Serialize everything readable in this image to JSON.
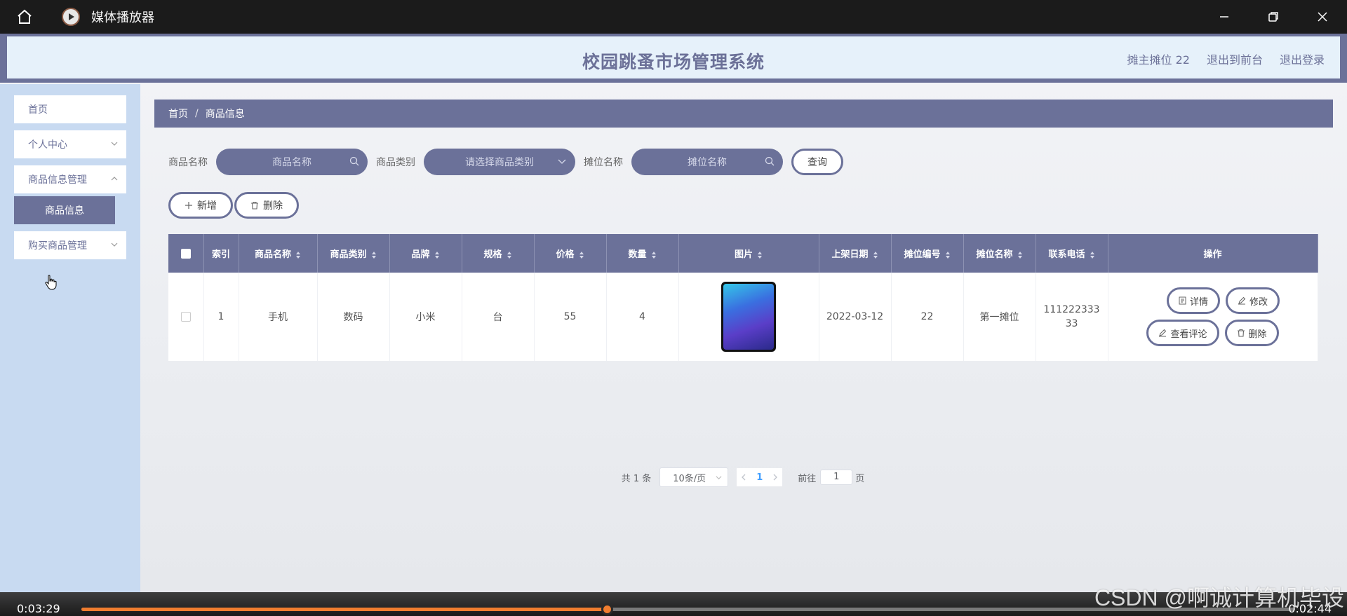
{
  "player": {
    "title": "媒体播放器",
    "time_current": "0:03:29",
    "time_remaining": "0:02:44",
    "progress": 0.433,
    "accent": "#f07d2f"
  },
  "watermark": "CSDN @啊诚计算机毕设",
  "header": {
    "title": "校园跳蚤市场管理系统",
    "links": [
      "摊主摊位 22",
      "退出到前台",
      "退出登录"
    ]
  },
  "sidebar": {
    "items": [
      {
        "label": "首页"
      },
      {
        "label": "个人中心"
      },
      {
        "label": "商品信息管理"
      },
      {
        "label": "商品信息"
      },
      {
        "label": "购买商品管理"
      }
    ]
  },
  "breadcrumb": {
    "home": "首页",
    "sep": "/",
    "current": "商品信息"
  },
  "search": {
    "name_label": "商品名称",
    "name_placeholder": "商品名称",
    "category_label": "商品类别",
    "category_placeholder": "请选择商品类别",
    "stall_label": "摊位名称",
    "stall_placeholder": "摊位名称",
    "query_button": "查询"
  },
  "actions": {
    "add": "新增",
    "delete": "删除"
  },
  "table": {
    "columns": [
      "索引",
      "商品名称",
      "商品类别",
      "品牌",
      "规格",
      "价格",
      "数量",
      "图片",
      "上架日期",
      "摊位编号",
      "摊位名称",
      "联系电话",
      "操作"
    ],
    "rows": [
      {
        "index": "1",
        "name": "手机",
        "category": "数码",
        "brand": "小米",
        "spec": "台",
        "price": "55",
        "qty": "4",
        "date": "2022-03-12",
        "stall_no": "22",
        "stall_name": "第一摊位",
        "phone_line1": "111222333",
        "phone_line2": "33",
        "ops": [
          "详情",
          "修改",
          "查看评论",
          "删除"
        ]
      }
    ]
  },
  "pager": {
    "total": "共 1 条",
    "page_size": "10条/页",
    "current": "1",
    "goto_prefix": "前往",
    "goto_value": "1",
    "goto_suffix": "页"
  },
  "colors": {
    "primary": "#6b7199",
    "header_bg": "#e6f1fa",
    "sidebar_bg": "#c8daf1"
  }
}
